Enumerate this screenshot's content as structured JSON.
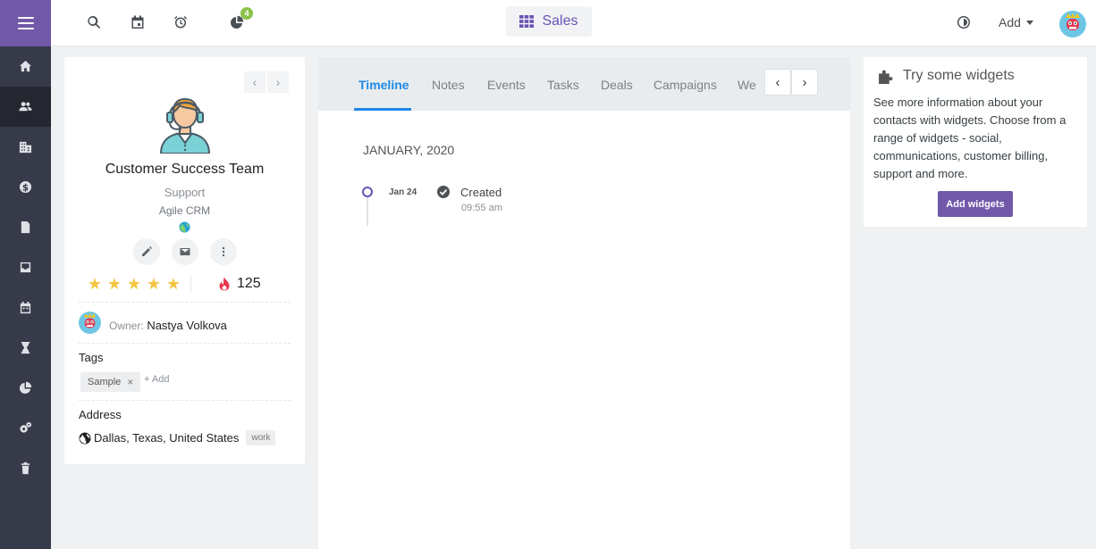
{
  "sidebar": {
    "items": [
      {
        "name": "home-icon"
      },
      {
        "name": "contacts-icon",
        "active": true
      },
      {
        "name": "companies-icon"
      },
      {
        "name": "deals-icon"
      },
      {
        "name": "documents-icon"
      },
      {
        "name": "inbox-icon"
      },
      {
        "name": "calendar-icon"
      },
      {
        "name": "hourglass-icon"
      },
      {
        "name": "reports-icon"
      },
      {
        "name": "settings-icon"
      },
      {
        "name": "trash-icon"
      }
    ]
  },
  "topbar": {
    "badge_count": "4",
    "sales_label": "Sales",
    "add_label": "Add"
  },
  "contact": {
    "name": "Customer Success Team",
    "role": "Support",
    "company": "Agile CRM",
    "rating": 5,
    "score": "125",
    "owner_label": "Owner:",
    "owner_name": "Nastya Volkova",
    "tags_title": "Tags",
    "tags": [
      "Sample"
    ],
    "tag_remove": "×",
    "tag_add_label": "+ Add",
    "address_title": "Address",
    "address": "Dallas, Texas, United States",
    "address_type": "work"
  },
  "timeline": {
    "tabs": [
      "Timeline",
      "Notes",
      "Events",
      "Tasks",
      "Deals",
      "Campaigns",
      "We"
    ],
    "active_tab": "Timeline",
    "month": "JANUARY, 2020",
    "entries": [
      {
        "date": "Jan 24",
        "title": "Created",
        "time": "09:55 am"
      }
    ]
  },
  "widgets": {
    "title": "Try some widgets",
    "description": "See more information about your contacts with widgets. Choose from a range of widgets - social, communications, customer billing, support and more.",
    "button_label": "Add widgets"
  },
  "colors": {
    "accent": "#7158a8",
    "sidebar": "#363a49",
    "link": "#1e88e5",
    "star": "#f4c542"
  }
}
